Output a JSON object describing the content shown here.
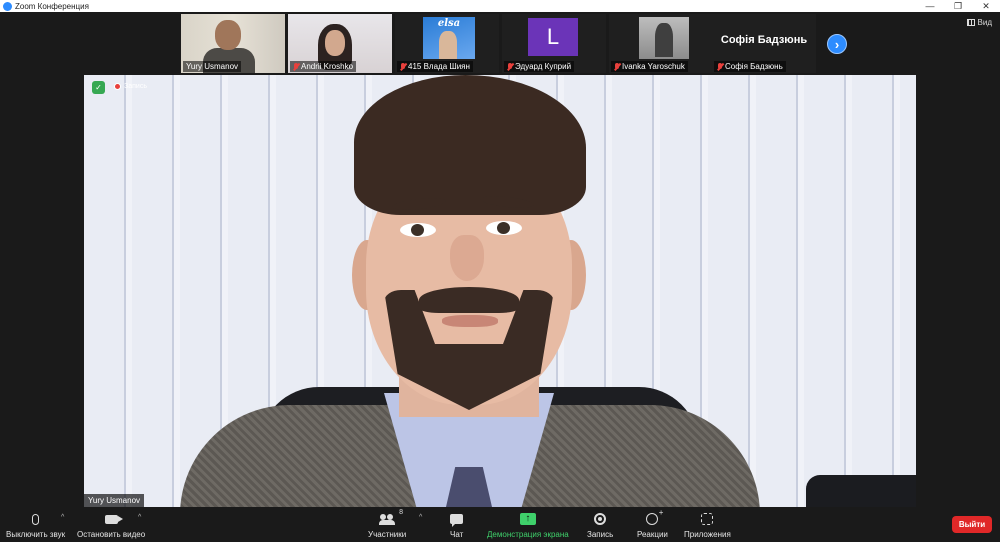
{
  "window": {
    "title": "Zoom Конференция",
    "controls": {
      "minimize": "—",
      "restore": "❐",
      "close": "✕"
    }
  },
  "strip": {
    "participants": [
      {
        "name": "Yury Usmanov",
        "muted": false
      },
      {
        "name": "Andrii Kroshko",
        "muted": true
      },
      {
        "name": "415 Влада Шиян",
        "muted": true,
        "poster_logo": "elsa"
      },
      {
        "name": "Эдуард Куприй",
        "muted": true,
        "avatar_letter": "L"
      },
      {
        "name": "Ivanka Yaroschuk",
        "muted": true
      },
      {
        "name": "Софія Бадзюнь",
        "muted": true,
        "display_name": "Софія Бадзюнь"
      }
    ],
    "next_label": "›",
    "view_label": "Вид"
  },
  "main": {
    "recording_label": "Запись",
    "speaker_name": "Yury Usmanov",
    "security_glyph": "✓"
  },
  "toolbar": {
    "mute_label": "Выключить звук",
    "video_label": "Остановить видео",
    "participants_label": "Участники",
    "participants_count": "8",
    "chat_label": "Чат",
    "share_label": "Демонстрация экрана",
    "share_glyph": "↑",
    "record_label": "Запись",
    "reactions_label": "Реакции",
    "apps_label": "Приложения",
    "leave_label": "Выйти",
    "caret": "^"
  },
  "colors": {
    "accent": "#2d8cff",
    "share_green": "#3fd06b",
    "leave_red": "#e02828",
    "active_speaker": "#8fbf3f"
  }
}
